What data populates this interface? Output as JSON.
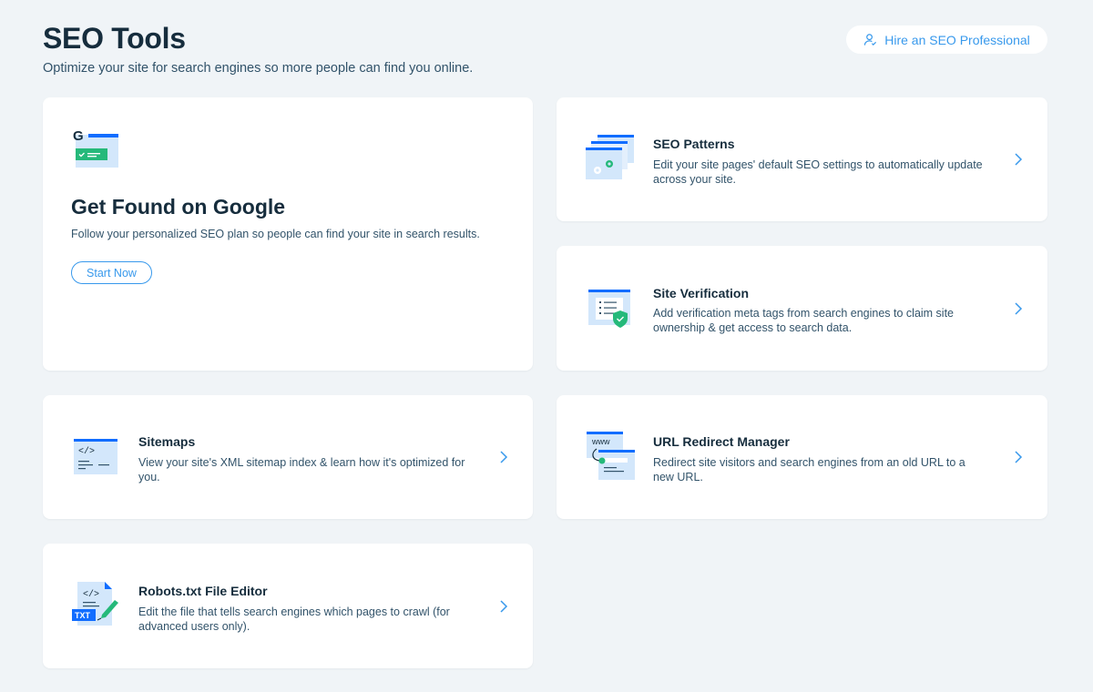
{
  "header": {
    "title": "SEO Tools",
    "subtitle": "Optimize your site for search engines so more people can find you online.",
    "hire_label": "Hire an SEO Professional"
  },
  "feature": {
    "title": "Get Found on Google",
    "description": "Follow your personalized SEO plan so people can find your site in search results.",
    "button_label": "Start Now",
    "icon": "google-search-icon"
  },
  "tools": [
    {
      "title": "SEO Patterns",
      "description_line1": "Edit your site pages' default SEO settings to automatically update",
      "description_line2": "across your site.",
      "icon": "seo-patterns-icon"
    },
    {
      "title": "Site Verification",
      "description_line1": "Add verification meta tags from search engines to claim site",
      "description_line2": "ownership & get access to search data.",
      "icon": "site-verification-icon"
    },
    {
      "title": "Sitemaps",
      "description_line1": "View your site's XML sitemap index & learn how it's optimized for",
      "description_line2": "you.",
      "icon": "sitemap-icon"
    },
    {
      "title": "URL Redirect Manager",
      "description_line1": "Redirect site visitors and search engines from an old URL to a",
      "description_line2": "new URL.",
      "icon": "url-redirect-icon",
      "icon_text": "www"
    },
    {
      "title": "Robots.txt File Editor",
      "description_line1": "Edit the file that tells search engines which pages to crawl (for",
      "description_line2": "advanced users only).",
      "icon": "robots-txt-icon",
      "icon_text": "TXT"
    }
  ],
  "colors": {
    "accent": "#3899EC",
    "background": "#F0F4F7",
    "title_text": "#162D3D",
    "body_text": "#32536A",
    "icon_light": "#D3E7FB",
    "icon_blue": "#116DFF",
    "icon_green": "#25B97A"
  }
}
